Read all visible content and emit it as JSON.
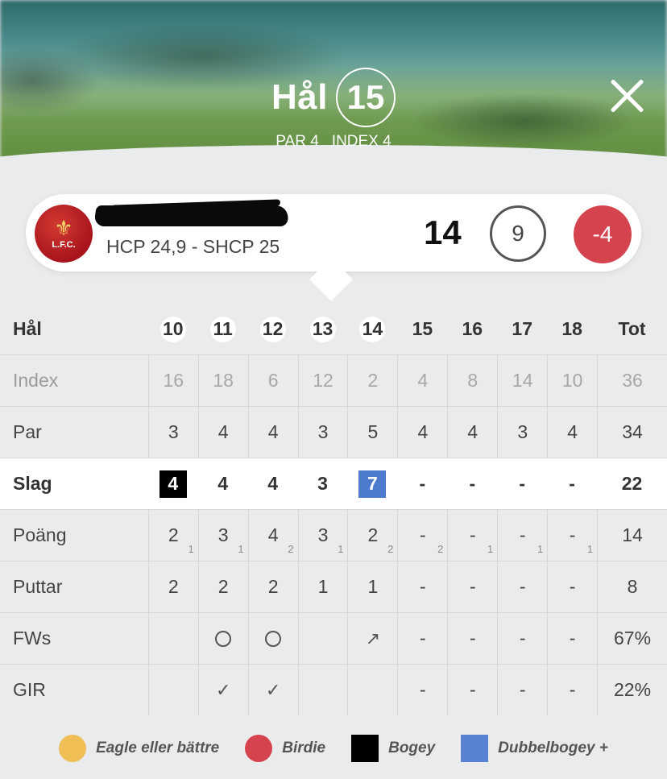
{
  "header": {
    "hole_label": "Hål",
    "hole_number": "15",
    "par": "PAR 4",
    "index": "INDEX 4",
    "close_icon": "close-icon"
  },
  "player": {
    "name": "",
    "club_initials": "L.F.C.",
    "hcp": "HCP 24,9 - SHCP 25",
    "strokes": "14",
    "points": "9",
    "diff": "-4"
  },
  "table": {
    "labels": {
      "hole": "Hål",
      "index": "Index",
      "par": "Par",
      "strokes": "Slag",
      "points": "Poäng",
      "putts": "Puttar",
      "fws": "FWs",
      "gir": "GIR"
    },
    "holes": [
      "10",
      "11",
      "12",
      "13",
      "14",
      "15",
      "16",
      "17",
      "18"
    ],
    "total_label": "Tot",
    "index": [
      "16",
      "18",
      "6",
      "12",
      "2",
      "4",
      "8",
      "14",
      "10"
    ],
    "index_total": "36",
    "par": [
      "3",
      "4",
      "4",
      "3",
      "5",
      "4",
      "4",
      "3",
      "4"
    ],
    "par_total": "34",
    "strokes": [
      "4",
      "4",
      "4",
      "3",
      "7",
      "-",
      "-",
      "-",
      "-"
    ],
    "strokes_marks": [
      "bogey",
      "",
      "",
      "",
      "dubbelbogey",
      "",
      "",
      "",
      ""
    ],
    "strokes_total": "22",
    "points": [
      "2",
      "3",
      "4",
      "3",
      "2",
      "-",
      "-",
      "-",
      "-"
    ],
    "points_sub": [
      "1",
      "1",
      "2",
      "1",
      "2",
      "2",
      "1",
      "1",
      "1"
    ],
    "points_total": "14",
    "putts": [
      "2",
      "2",
      "2",
      "1",
      "1",
      "-",
      "-",
      "-",
      "-"
    ],
    "putts_total": "8",
    "fws": [
      "",
      "○",
      "○",
      "",
      "↗",
      "-",
      "-",
      "-",
      "-"
    ],
    "fws_total": "67%",
    "gir": [
      "",
      "✓",
      "✓",
      "",
      "",
      "-",
      "-",
      "-",
      "-"
    ],
    "gir_total": "22%"
  },
  "legend": {
    "eagle": "Eagle eller bättre",
    "birdie": "Birdie",
    "bogey": "Bogey",
    "dbl": "Dubbelbogey +"
  },
  "colors": {
    "eagle": "#efbf55",
    "birdie": "#d5434f",
    "bogey": "#000000",
    "dubbelbogey": "#5983d2"
  }
}
